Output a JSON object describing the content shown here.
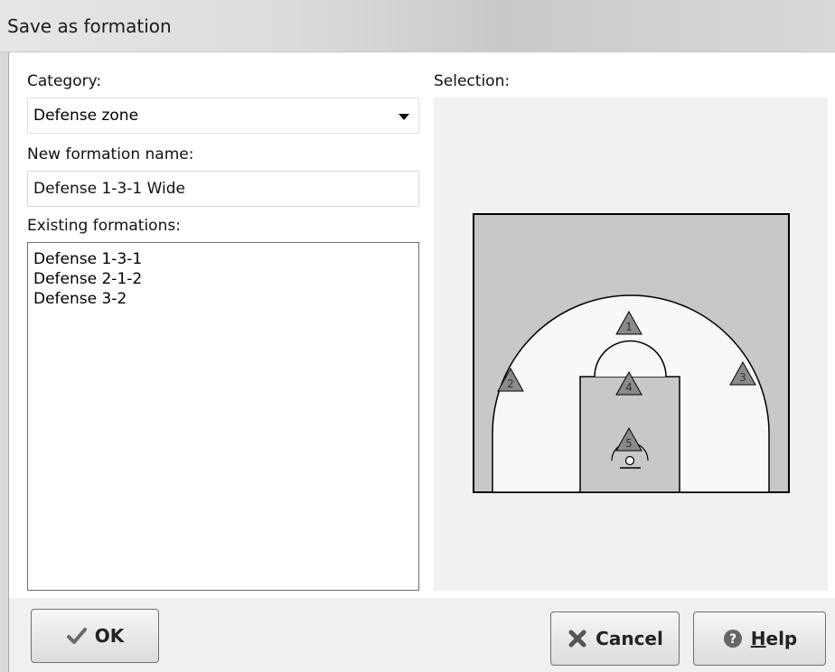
{
  "window": {
    "title": "Save as formation"
  },
  "form": {
    "category_label": "Category:",
    "category_value": "Defense zone",
    "name_label": "New formation name:",
    "name_value": "Defense 1-3-1 Wide",
    "existing_label": "Existing formations:",
    "existing_items": [
      "Defense 1-3-1",
      "Defense 2-1-2",
      "Defense 3-2"
    ],
    "selection_label": "Selection:"
  },
  "court": {
    "players": [
      {
        "number": "1"
      },
      {
        "number": "2"
      },
      {
        "number": "3"
      },
      {
        "number": "4"
      },
      {
        "number": "5"
      }
    ],
    "colors": {
      "court": "#c8c8c8",
      "zone": "#f8f8f8",
      "lines": "#000000",
      "player": "#8a8a8a"
    }
  },
  "buttons": {
    "ok": "OK",
    "cancel": "Cancel",
    "help_prefix": "H",
    "help_rest": "elp"
  },
  "icons": {
    "ok": "checkmark-icon",
    "cancel": "cross-icon",
    "help": "question-icon"
  }
}
